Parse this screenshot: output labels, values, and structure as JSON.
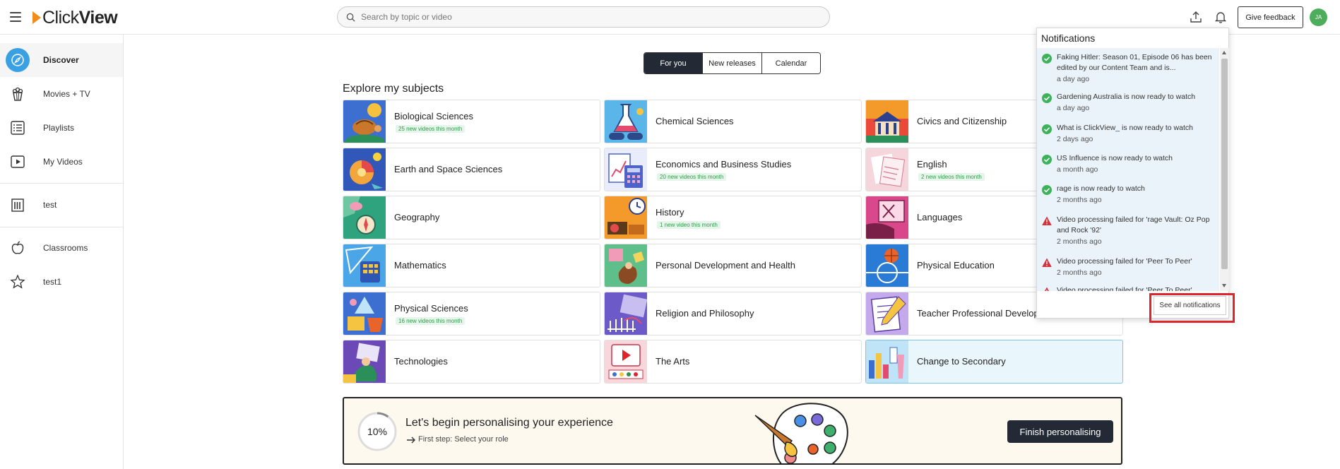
{
  "header": {
    "logo_prefix": "Click",
    "logo_suffix": "View",
    "search_placeholder": "Search by topic or video",
    "feedback_label": "Give feedback",
    "avatar_initials": "JA"
  },
  "sidebar": {
    "items": [
      {
        "label": "Discover",
        "icon": "compass-icon",
        "active": true
      },
      {
        "label": "Movies + TV",
        "icon": "popcorn-icon"
      },
      {
        "label": "Playlists",
        "icon": "list-icon"
      },
      {
        "label": "My Videos",
        "icon": "play-square-icon"
      },
      {
        "label": "test",
        "icon": "library-icon"
      },
      {
        "label": "Classrooms",
        "icon": "apple-icon"
      },
      {
        "label": "test1",
        "icon": "star-icon"
      }
    ]
  },
  "tabs": [
    {
      "label": "For you",
      "active": true
    },
    {
      "label": "New releases"
    },
    {
      "label": "Calendar"
    }
  ],
  "section_title": "Explore my subjects",
  "subjects": [
    {
      "name": "Biological Sciences",
      "badge": "25 new videos this month"
    },
    {
      "name": "Chemical Sciences",
      "badge": ""
    },
    {
      "name": "Civics and Citizenship",
      "badge": ""
    },
    {
      "name": "Earth and Space Sciences",
      "badge": ""
    },
    {
      "name": "Economics and Business Studies",
      "badge": "20 new videos this month"
    },
    {
      "name": "English",
      "badge": "2 new videos this month"
    },
    {
      "name": "Geography",
      "badge": ""
    },
    {
      "name": "History",
      "badge": "1 new video this month"
    },
    {
      "name": "Languages",
      "badge": ""
    },
    {
      "name": "Mathematics",
      "badge": ""
    },
    {
      "name": "Personal Development and Health",
      "badge": ""
    },
    {
      "name": "Physical Education",
      "badge": ""
    },
    {
      "name": "Physical Sciences",
      "badge": "16 new videos this month"
    },
    {
      "name": "Religion and Philosophy",
      "badge": ""
    },
    {
      "name": "Teacher Professional Development",
      "badge": ""
    },
    {
      "name": "Technologies",
      "badge": ""
    },
    {
      "name": "The Arts",
      "badge": ""
    },
    {
      "name": "Change to Secondary",
      "badge": "",
      "highlight": true
    }
  ],
  "banner": {
    "progress": 10,
    "progress_label": "10%",
    "title": "Let's begin personalising your experience",
    "subtitle": "First step: Select your role",
    "button_label": "Finish personalising"
  },
  "notifications": {
    "title": "Notifications",
    "items": [
      {
        "status": "success",
        "text": "Faking Hitler: Season 01, Episode 06 has been edited by our Content Team and is...",
        "time": "a day ago"
      },
      {
        "status": "success",
        "text": "Gardening Australia is now ready to watch",
        "time": "a day ago"
      },
      {
        "status": "success",
        "text": "What is ClickView_ is now ready to watch",
        "time": "2 days ago"
      },
      {
        "status": "success",
        "text": "US Influence is now ready to watch",
        "time": "a month ago"
      },
      {
        "status": "success",
        "text": "rage is now ready to watch",
        "time": "2 months ago"
      },
      {
        "status": "error",
        "text": "Video processing failed for 'rage Vault: Oz Pop and Rock '92'",
        "time": "2 months ago"
      },
      {
        "status": "error",
        "text": "Video processing failed for 'Peer To Peer'",
        "time": "2 months ago"
      },
      {
        "status": "error",
        "text": "Video processing failed for 'Peer To Peer'",
        "time": ""
      }
    ],
    "see_all_label": "See all notifications"
  },
  "colors": {
    "accent": "#3aa0e4",
    "success": "#3cb35a",
    "error": "#d8303a",
    "dark": "#232a35",
    "highlight": "#e0242c"
  }
}
